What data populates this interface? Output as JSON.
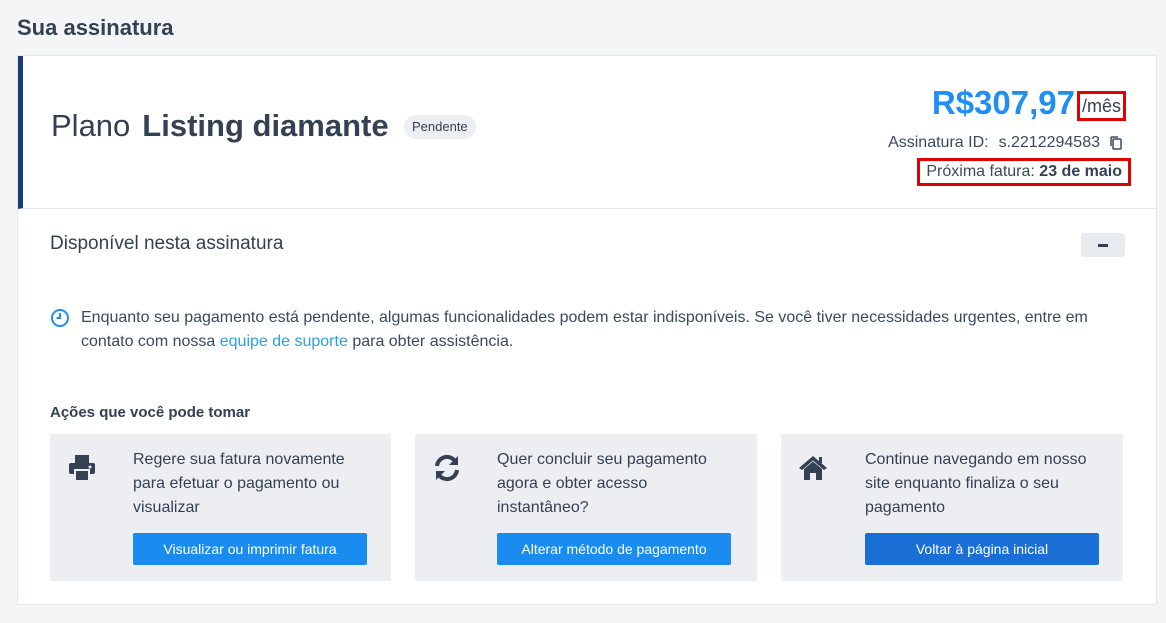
{
  "page_title": "Sua assinatura",
  "plan": {
    "prefix": "Plano",
    "name": "Listing diamante",
    "status_badge": "Pendente",
    "price": "R$307,97",
    "period": "/mês",
    "subscription_id_label": "Assinatura ID:",
    "subscription_id": "s.2212294583",
    "next_invoice_label": "Próxima fatura:",
    "next_invoice_date": "23 de maio"
  },
  "available": {
    "title": "Disponível nesta assinatura",
    "notice_text_1": "Enquanto seu pagamento está pendente, algumas funcionalidades podem estar indisponíveis. Se você tiver necessidades urgentes, entre em contato com nossa",
    "notice_link": "equipe de suporte",
    "notice_text_2": "para obter assistência."
  },
  "actions": {
    "title": "Ações que você pode tomar",
    "items": [
      {
        "icon": "printer-icon",
        "description": "Regere sua fatura novamente para efetuar o pagamento ou visualizar",
        "button": "Visualizar ou imprimir fatura"
      },
      {
        "icon": "refresh-icon",
        "description": "Quer concluir seu pagamento agora e obter acesso instantâneo?",
        "button": "Alterar método de pagamento"
      },
      {
        "icon": "home-icon",
        "description": "Continue navegando em nosso site enquanto finaliza o seu pagamento",
        "button": "Voltar à página inicial"
      }
    ]
  },
  "colors": {
    "accent": "#1f8ff5",
    "primary_button": "#1a8cf0",
    "secondary_button": "#1a6fd6",
    "header_border": "#1a3a7a",
    "highlight": "#e00000"
  }
}
